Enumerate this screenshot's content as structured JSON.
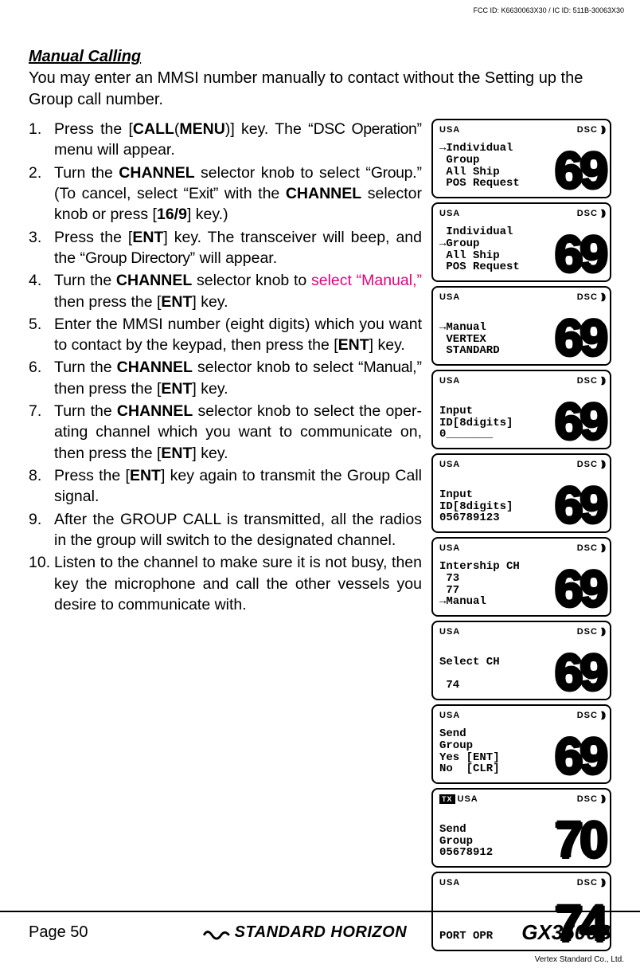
{
  "header": {
    "fcc_id": "FCC ID: K6630063X30 / IC ID: 511B-30063X30"
  },
  "section": {
    "title": "Manual Calling",
    "intro": "You may enter an MMSI number manually to contact without the Setting up the Group call number."
  },
  "steps": {
    "s1a": "Press the [",
    "s1_call": "CALL",
    "s1_paren": "(",
    "s1_menu": "MENU",
    "s1b": ")] key. The “",
    "s1_dsc": "DSC Operation",
    "s1c": "” menu will appear.",
    "s2a": "Turn the ",
    "s2_channel": "CHANNEL",
    "s2b": " selector knob to select “",
    "s2_group": "Group",
    "s2c": ".” (To cancel, select “",
    "s2_exit": "Exit",
    "s2d": "” with the ",
    "s2_channel2": "CHANNEL",
    "s2e": " selector knob or press [",
    "s2_169": "16/9",
    "s2f": "] key.)",
    "s3a": "Press the [",
    "s3_ent": "ENT",
    "s3b": "] key. The transceiver will beep, and the “",
    "s3_gd": "Group Directory",
    "s3c": "” will appear.",
    "s4a": "Turn the ",
    "s4_channel": "CHANNEL",
    "s4b": " selector knob to ",
    "s4_pink": "select “Manual,”",
    "s4c": " then press the [",
    "s4_ent": "ENT",
    "s4d": "] key.",
    "s5a": "Enter the MMSI number (eight digits) which you want to contact by the keypad, then press the [",
    "s5_ent": "ENT",
    "s5b": "] key.",
    "s6a": "Turn the ",
    "s6_channel": "CHANNEL",
    "s6b": " selector knob to select “",
    "s6_manual": "Manual",
    "s6c": ",” then press the [",
    "s6_ent": "ENT",
    "s6d": "] key.",
    "s7a": "Turn the ",
    "s7_channel": "CHANNEL",
    "s7b": " selector knob to select the oper-ating channel which you want to communicate on, then press the [",
    "s7_ent": "ENT",
    "s7c": "] key.",
    "s8a": "Press the [",
    "s8_ent": "ENT",
    "s8b": "] key again to transmit the Group Call signal.",
    "s9": "After the GROUP CALL is transmitted, all the radios in the group will switch to the designated channel.",
    "s10": "Listen to the channel to make sure it is not busy, then key the microphone and call the other vessels you desire to communicate with."
  },
  "lcd": {
    "usa": "USA",
    "dsc": "DSC",
    "wave": "⦆⦆⦆",
    "tx": "TX",
    "d1_text": "→Individual\n Group\n All Ship\n POS Request",
    "d1_big": "69",
    "d2_text": " Individual\n→Group\n All Ship\n POS Request",
    "d2_big": "69",
    "d3_text": "→Manual\n VERTEX\n STANDARD",
    "d3_big": "69",
    "d4_text": "Input\nID[8digits]\n0_______",
    "d4_big": "69",
    "d5_text": "Input\nID[8digits]\n056789123",
    "d5_big": "69",
    "d6_text": "Intership CH\n 73\n 77\n→Manual",
    "d6_big": "69",
    "d7_text": "Select CH\n\n 74",
    "d7_big": "69",
    "d8_text": "Send\nGroup\nYes [ENT]\nNo  [CLR]",
    "d8_big": "69",
    "d9_text": "Send\nGroup\n05678912",
    "d9_big": "70",
    "d10_text": "\n\n\nPORT OPR",
    "d10_big": "74"
  },
  "footer": {
    "page": "Page 50",
    "brand": "STANDARD HORIZON",
    "model": "GX3500S",
    "copyright": "Vertex Standard Co., Ltd."
  }
}
